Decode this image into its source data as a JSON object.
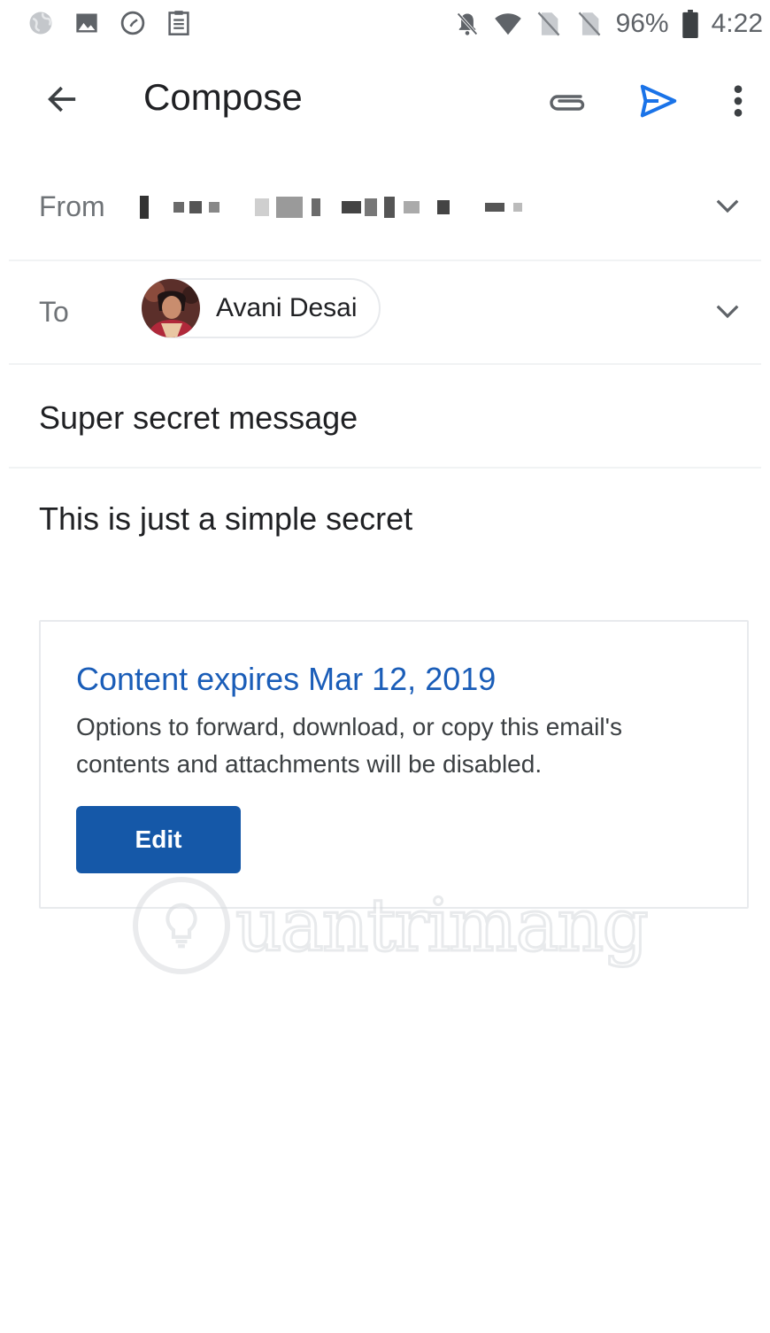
{
  "status_bar": {
    "left_icons": [
      "globe-icon",
      "image-icon",
      "clock-icon",
      "clipboard-icon"
    ],
    "right_icons": [
      "notifications-off-icon",
      "wifi-icon",
      "no-sim-icon",
      "no-sim-icon",
      "battery-icon"
    ],
    "battery": "96%",
    "time": "4:22"
  },
  "app_bar": {
    "title": "Compose",
    "back_icon": "arrow-back-icon",
    "attach_icon": "paperclip-icon",
    "send_icon": "send-icon",
    "more_icon": "more-vert-icon"
  },
  "from": {
    "label": "From"
  },
  "to": {
    "label": "To",
    "recipient": "Avani Desai"
  },
  "subject": "Super secret message",
  "body": "This is just a simple secret",
  "confidential": {
    "title": "Content expires Mar 12, 2019",
    "description": "Options to forward, download, or copy this email's contents and attachments will be disabled.",
    "edit_label": "Edit"
  },
  "watermark": "uantrimang",
  "colors": {
    "accent": "#1a73e8",
    "card_title": "#1a5db8",
    "edit_button": "#1558a8",
    "label_gray": "#6f7377"
  }
}
